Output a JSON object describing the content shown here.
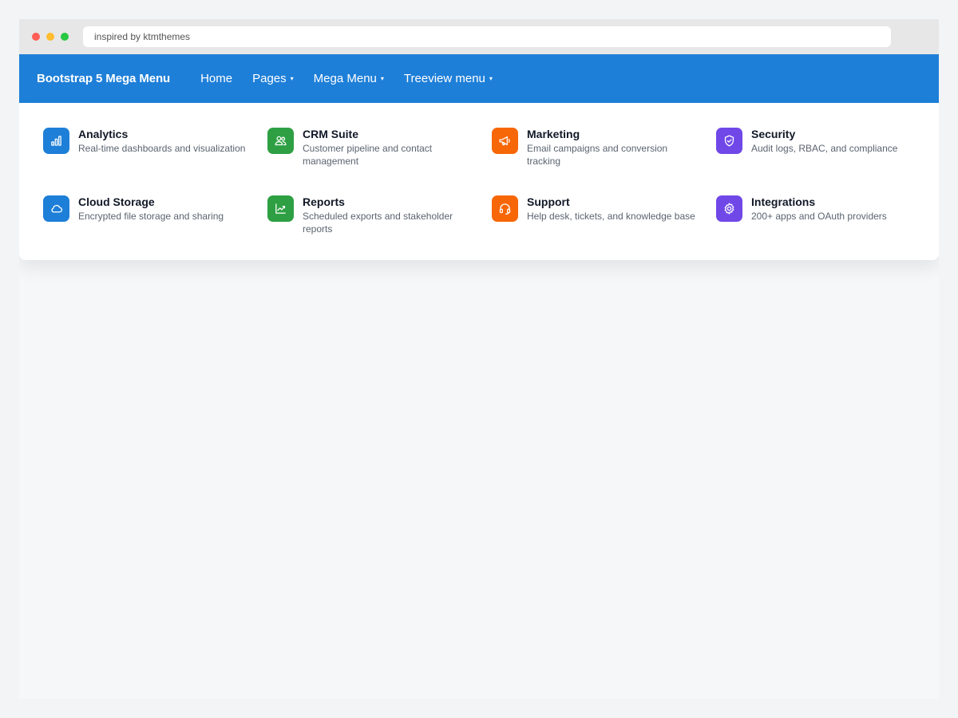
{
  "browser": {
    "address_text": "inspired by ktmthemes"
  },
  "navbar": {
    "brand": "Bootstrap 5 Mega Menu",
    "items": [
      {
        "label": "Home",
        "has_caret": false
      },
      {
        "label": "Pages",
        "has_caret": true
      },
      {
        "label": "Mega Menu",
        "has_caret": true
      },
      {
        "label": "Treeview menu",
        "has_caret": true
      }
    ],
    "caret_glyph": "▾",
    "background_color": "#1e7fd8"
  },
  "mega_menu": {
    "items": [
      {
        "title": "Analytics",
        "description": "Real-time dashboards and visualization",
        "icon": "bar-chart-icon",
        "color": "#1e7fd8"
      },
      {
        "title": "CRM Suite",
        "description": "Customer pipeline and contact management",
        "icon": "users-icon",
        "color": "#2ea043"
      },
      {
        "title": "Marketing",
        "description": "Email campaigns and conversion tracking",
        "icon": "megaphone-icon",
        "color": "#f76707"
      },
      {
        "title": "Security",
        "description": "Audit logs, RBAC, and compliance",
        "icon": "shield-icon",
        "color": "#7048e8"
      },
      {
        "title": "Cloud Storage",
        "description": "Encrypted file storage and sharing",
        "icon": "cloud-icon",
        "color": "#1e7fd8"
      },
      {
        "title": "Reports",
        "description": "Scheduled exports and stakeholder reports",
        "icon": "trend-chart-icon",
        "color": "#2ea043"
      },
      {
        "title": "Support",
        "description": "Help desk, tickets, and knowledge base",
        "icon": "headset-icon",
        "color": "#f76707"
      },
      {
        "title": "Integrations",
        "description": "200+ apps and OAuth providers",
        "icon": "gear-icon",
        "color": "#7048e8"
      }
    ]
  }
}
